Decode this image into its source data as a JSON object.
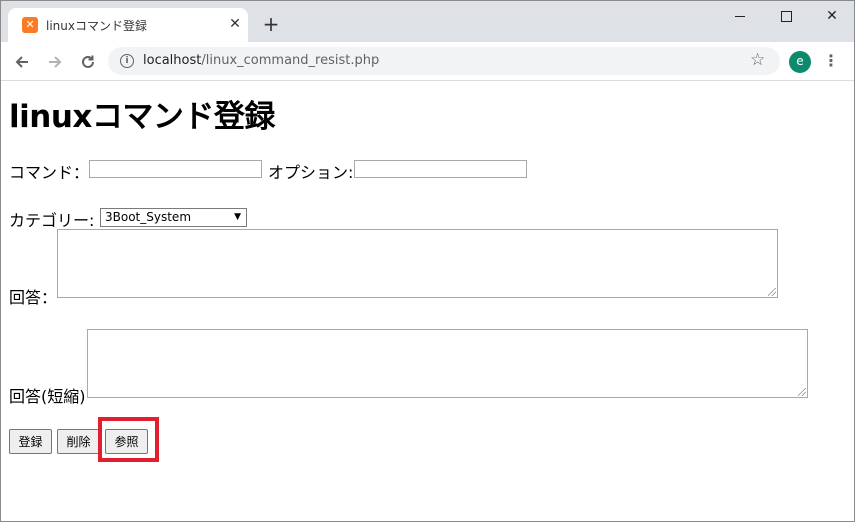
{
  "browser": {
    "tab_title": "linuxコマンド登録",
    "tab_favicon": "xampp-icon",
    "url_host": "localhost",
    "url_path": "/linux_command_resist.php",
    "avatar_letter": "e"
  },
  "page": {
    "title": "linuxコマンド登録",
    "command_label": "コマンド：",
    "command_value": "",
    "option_label": "オプション:",
    "option_value": "",
    "category_label": "カテゴリー:",
    "category_selected": "3Boot_System",
    "answer_label": "回答：",
    "answer_value": "",
    "short_answer_label": "回答(短縮)",
    "short_answer_value": "",
    "buttons": {
      "register": "登録",
      "delete": "削除",
      "browse": "参照"
    },
    "highlight_color": "#e0202e"
  }
}
